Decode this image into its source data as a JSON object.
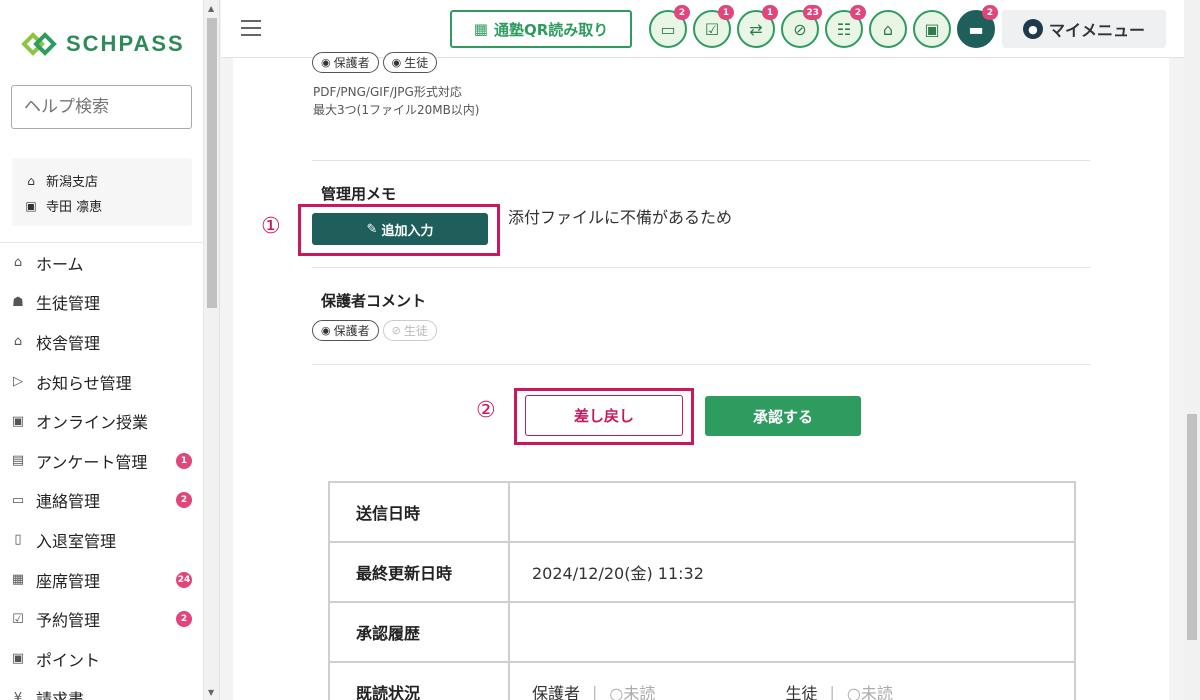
{
  "app": {
    "brand": "SCHPASS"
  },
  "sidebar": {
    "help_search_placeholder": "ヘルプ検索",
    "branch": "新潟支店",
    "user": "寺田 凛恵",
    "items": [
      {
        "label": "ホーム",
        "icon": "home-icon",
        "glyph": "⌂"
      },
      {
        "label": "生徒管理",
        "icon": "student-icon",
        "glyph": "☗"
      },
      {
        "label": "校舎管理",
        "icon": "school-icon",
        "glyph": "⌂"
      },
      {
        "label": "お知らせ管理",
        "icon": "send-icon",
        "glyph": "▷"
      },
      {
        "label": "オンライン授業",
        "icon": "monitor-icon",
        "glyph": "▣"
      },
      {
        "label": "アンケート管理",
        "icon": "survey-icon",
        "glyph": "▤",
        "badge": "1"
      },
      {
        "label": "連絡管理",
        "icon": "chat-icon",
        "glyph": "▭",
        "badge": "2"
      },
      {
        "label": "入退室管理",
        "icon": "door-icon",
        "glyph": "▯"
      },
      {
        "label": "座席管理",
        "icon": "seat-icon",
        "glyph": "▦",
        "badge": "24"
      },
      {
        "label": "予約管理",
        "icon": "calendar-check-icon",
        "glyph": "☑",
        "badge": "2"
      },
      {
        "label": "ポイント",
        "icon": "gift-icon",
        "glyph": "▣"
      },
      {
        "label": "請求書",
        "icon": "yen-icon",
        "glyph": "¥"
      }
    ]
  },
  "topbar": {
    "qr_label": "通塾QR読み取り",
    "icons": [
      {
        "name": "message-icon",
        "glyph": "▭",
        "badge": "2"
      },
      {
        "name": "checklist-icon",
        "glyph": "☑",
        "badge": "1"
      },
      {
        "name": "transfer-icon",
        "glyph": "⇄",
        "badge": "1"
      },
      {
        "name": "absence-icon",
        "glyph": "⊘",
        "badge": "23"
      },
      {
        "name": "group-icon",
        "glyph": "☷",
        "badge": "2"
      },
      {
        "name": "bank-icon",
        "glyph": "⌂",
        "badge": ""
      },
      {
        "name": "gift-icon",
        "glyph": "▣",
        "badge": ""
      },
      {
        "name": "chat-dark-icon",
        "glyph": "▬",
        "badge": "2"
      }
    ],
    "mymenu_label": "マイメニュー"
  },
  "main": {
    "attach_tag_guardian": "保護者",
    "attach_tag_student": "生徒",
    "attach_formats": "PDF/PNG/GIF/JPG形式対応",
    "attach_limit": "最大3つ(1ファイル20MB以内)",
    "memo_title": "管理用メモ",
    "add_input_label": "追加入力",
    "memo_text": "添付ファイルに不備があるため",
    "marker1": "①",
    "comment_title": "保護者コメント",
    "comment_tag_guardian": "保護者",
    "comment_tag_student": "生徒",
    "marker2": "②",
    "return_label": "差し戻し",
    "approve_label": "承認する",
    "table": {
      "sent_label": "送信日時",
      "sent_value": "",
      "updated_label": "最終更新日時",
      "updated_value": "2024/12/20(金) 11:32",
      "history_label": "承認履歴",
      "history_value": "",
      "read_label": "既読状況",
      "read_guardian": "保護者",
      "read_guardian_status": "○未読",
      "read_student": "生徒",
      "read_student_status": "○未読",
      "sep": "|"
    }
  }
}
